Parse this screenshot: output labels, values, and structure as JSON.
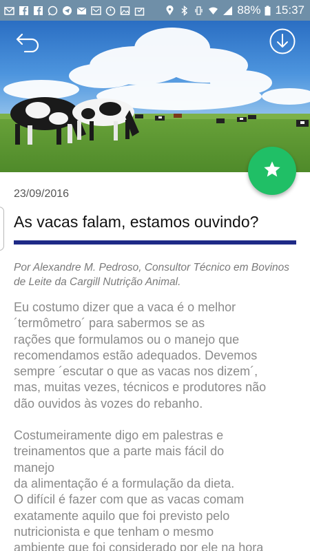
{
  "status_bar": {
    "battery_percent": "88%",
    "time": "15:37",
    "left_icons": [
      "gmail-icon",
      "facebook-icon",
      "facebook-icon",
      "whatsapp-icon",
      "telegram-icon",
      "email-icon",
      "messenger-icon",
      "timer-icon",
      "image-icon",
      "bag-icon"
    ],
    "right_icons": [
      "location-icon",
      "bluetooth-icon",
      "vibrate-icon",
      "wifi-icon",
      "signal-icon",
      "battery-icon"
    ]
  },
  "header": {
    "back_icon": "back-arrow-icon",
    "download_icon": "download-icon"
  },
  "fab": {
    "icon": "star-icon",
    "color": "#20bf66"
  },
  "article": {
    "date": "23/09/2016",
    "title": "As vacas falam, estamos ouvindo?",
    "rule_color": "#1e2a86",
    "byline": "Por Alexandre M. Pedroso, Consultor Técnico em Bovinos de Leite da Cargill Nutrição Animal.",
    "paragraph_1": "Eu costumo dizer que a vaca é o melhor\n´termômetro´ para sabermos se as\nrações que formulamos ou o manejo que\nrecomendamos estão adequados. Devemos\nsempre ´escutar o que as vacas nos dizem´,\nmas, muitas vezes, técnicos e produtores não\ndão ouvidos às vozes do rebanho.",
    "paragraph_2": "Costumeiramente digo em palestras e\ntreinamentos que a parte mais fácil do\nmanejo\nda alimentação é a formulação da dieta.\nO difícil é fazer com que as vacas comam\nexatamente aquilo que foi previsto pelo\nnutricionista e que tenham o mesmo\nambiente que foi considerado por ele na hora"
  }
}
